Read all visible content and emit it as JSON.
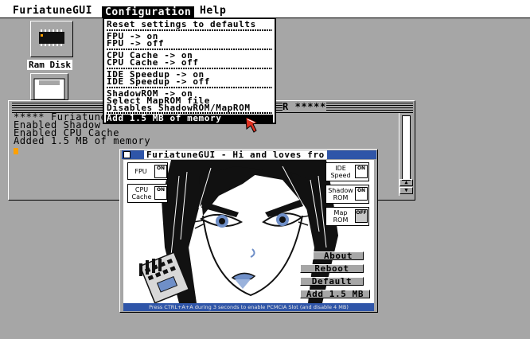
{
  "menubar": {
    "items": [
      "FuriatuneGUI",
      "Configuration",
      "Help"
    ]
  },
  "desktop": {
    "icons": [
      {
        "label": "Ram Disk",
        "icon": "ram-chip-icon"
      },
      {
        "label": "",
        "icon": "disk-drive-icon"
      }
    ]
  },
  "shell": {
    "lines": [
      "***** Furiatune",
      "Enabled Shadow",
      "Enabled CPU Cache",
      "Added 1.5 MB of memory"
    ],
    "title_tail": "R *****"
  },
  "dropdown": {
    "groups": [
      [
        "Reset settings to defaults"
      ],
      [
        "FPU -> on",
        "FPU -> off"
      ],
      [
        "CPU Cache -> on",
        "CPU Cache -> off"
      ],
      [
        "IDE Speedup -> on",
        "IDE Speedup -> off"
      ],
      [
        "ShadowROM -> on",
        "Select MapROM file",
        "Disables ShadowROM/MapROM"
      ]
    ],
    "selected": "Add 1.5 MB of memory"
  },
  "furiatune_window": {
    "title": "FuriatuneGUI - Hi and loves fro",
    "toggles": {
      "fpu": {
        "label": "FPU",
        "state": "ON"
      },
      "cpu_cache": {
        "label_1": "CPU",
        "label_2": "Cache",
        "state": "ON"
      },
      "ide_speed": {
        "label_1": "IDE",
        "label_2": "Speed",
        "state": "ON"
      },
      "shadow_rom": {
        "label_1": "Shadow",
        "label_2": "ROM",
        "state": "ON"
      },
      "map_rom": {
        "label_1": "Map",
        "label_2": "ROM",
        "state": "OFF"
      }
    },
    "buttons": {
      "about": "About",
      "reboot": "Reboot",
      "default": "Default",
      "add_memory": "Add 1.5 MB"
    },
    "status": "Press CTRL+A+A during 3 seconds to enable PCMCIA Slot (and disable 4 MB)"
  },
  "colors": {
    "desktop": "#a6a6a6",
    "title_blue": "#2f55a8",
    "cursor_orange": "#ffa000",
    "pointer_red": "#e03020"
  }
}
